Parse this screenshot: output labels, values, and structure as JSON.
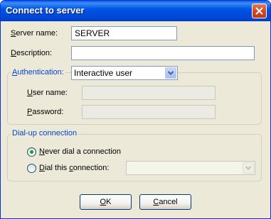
{
  "window": {
    "title": "Connect to server"
  },
  "server_name": {
    "label_key": "S",
    "label_rest": "erver name:",
    "value": "SERVER"
  },
  "description": {
    "label_key": "D",
    "label_rest": "escription:",
    "value": ""
  },
  "authentication": {
    "label_key": "A",
    "label_rest": "uthentication:",
    "selected": "Interactive user",
    "user_name": {
      "label_key": "U",
      "label_rest": "ser name:",
      "value": ""
    },
    "password": {
      "label_key": "P",
      "label_rest": "assword:",
      "value": ""
    }
  },
  "dialup": {
    "group_label": "Dial-up connection",
    "never": {
      "label_key": "N",
      "label_rest": "ever dial a connection",
      "checked": true
    },
    "dial_this": {
      "label_key": "D",
      "label_rest": "ial this ",
      "label_key2": "c",
      "label_rest2": "onnection:",
      "checked": false,
      "selected": ""
    }
  },
  "buttons": {
    "ok": {
      "label_key": "O",
      "label_rest": "K"
    },
    "cancel": {
      "label_key": "C",
      "label_rest": "ancel"
    }
  },
  "colors": {
    "title_bar": "#0054e3",
    "dialog_bg": "#ece9d8",
    "group_label": "#0046d5",
    "radio_dot": "#21a121"
  },
  "icons": {
    "close": "close-x-icon",
    "dropdown": "chevron-down-icon"
  }
}
